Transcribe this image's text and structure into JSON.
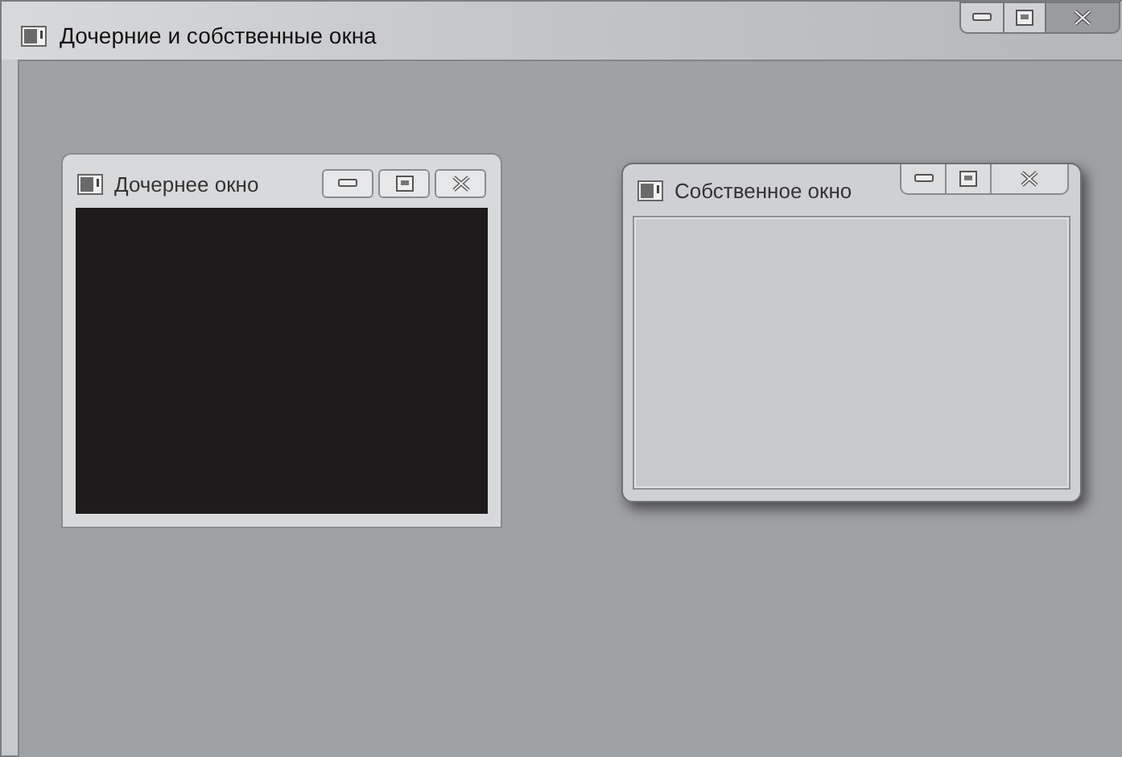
{
  "window": {
    "title": "Дочерние и собственные окна"
  },
  "child_windows": [
    {
      "kind": "child",
      "title": "Дочернее окно"
    },
    {
      "kind": "owned",
      "title": "Собственное окно"
    }
  ]
}
